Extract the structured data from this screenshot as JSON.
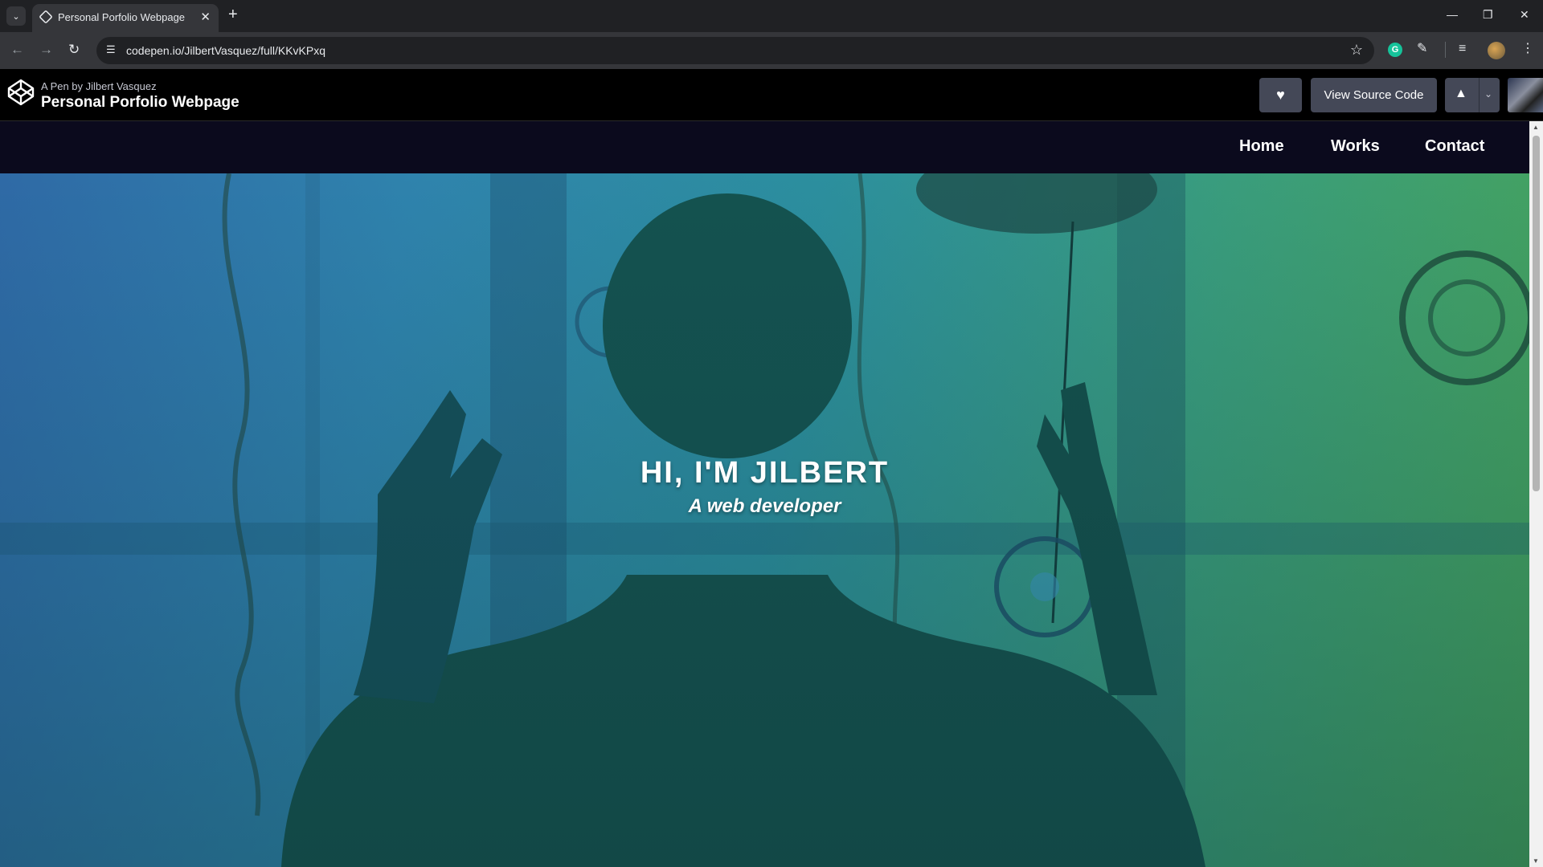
{
  "browser": {
    "tab_title": "Personal Porfolio Webpage",
    "url": "codepen.io/JilbertVasquez/full/KKvKPxq"
  },
  "codepen": {
    "byline": "A Pen by Jilbert Vasquez",
    "pen_title": "Personal Porfolio Webpage",
    "view_source_label": "View Source Code"
  },
  "site": {
    "nav": [
      "Home",
      "Works",
      "Contact"
    ],
    "hero_title": "HI, I'M JILBERT",
    "hero_subtitle": "A web developer"
  },
  "colors": {
    "codepen_bar": "#000000",
    "codepen_button": "#444857",
    "site_nav": "#0b0a1d",
    "hero_blue": "#2f6aa6",
    "hero_green": "#46a35a"
  },
  "icons": {
    "tab_search": "chevron-down-icon",
    "favicon": "codepen-icon",
    "new_tab": "plus-icon",
    "back": "arrow-left-icon",
    "forward": "arrow-right-icon",
    "reload": "reload-icon",
    "site_info": "tune-icon",
    "bookmark": "star-icon",
    "extensions": "puzzle-icon",
    "heart": "heart-icon",
    "pin": "pin-icon"
  }
}
